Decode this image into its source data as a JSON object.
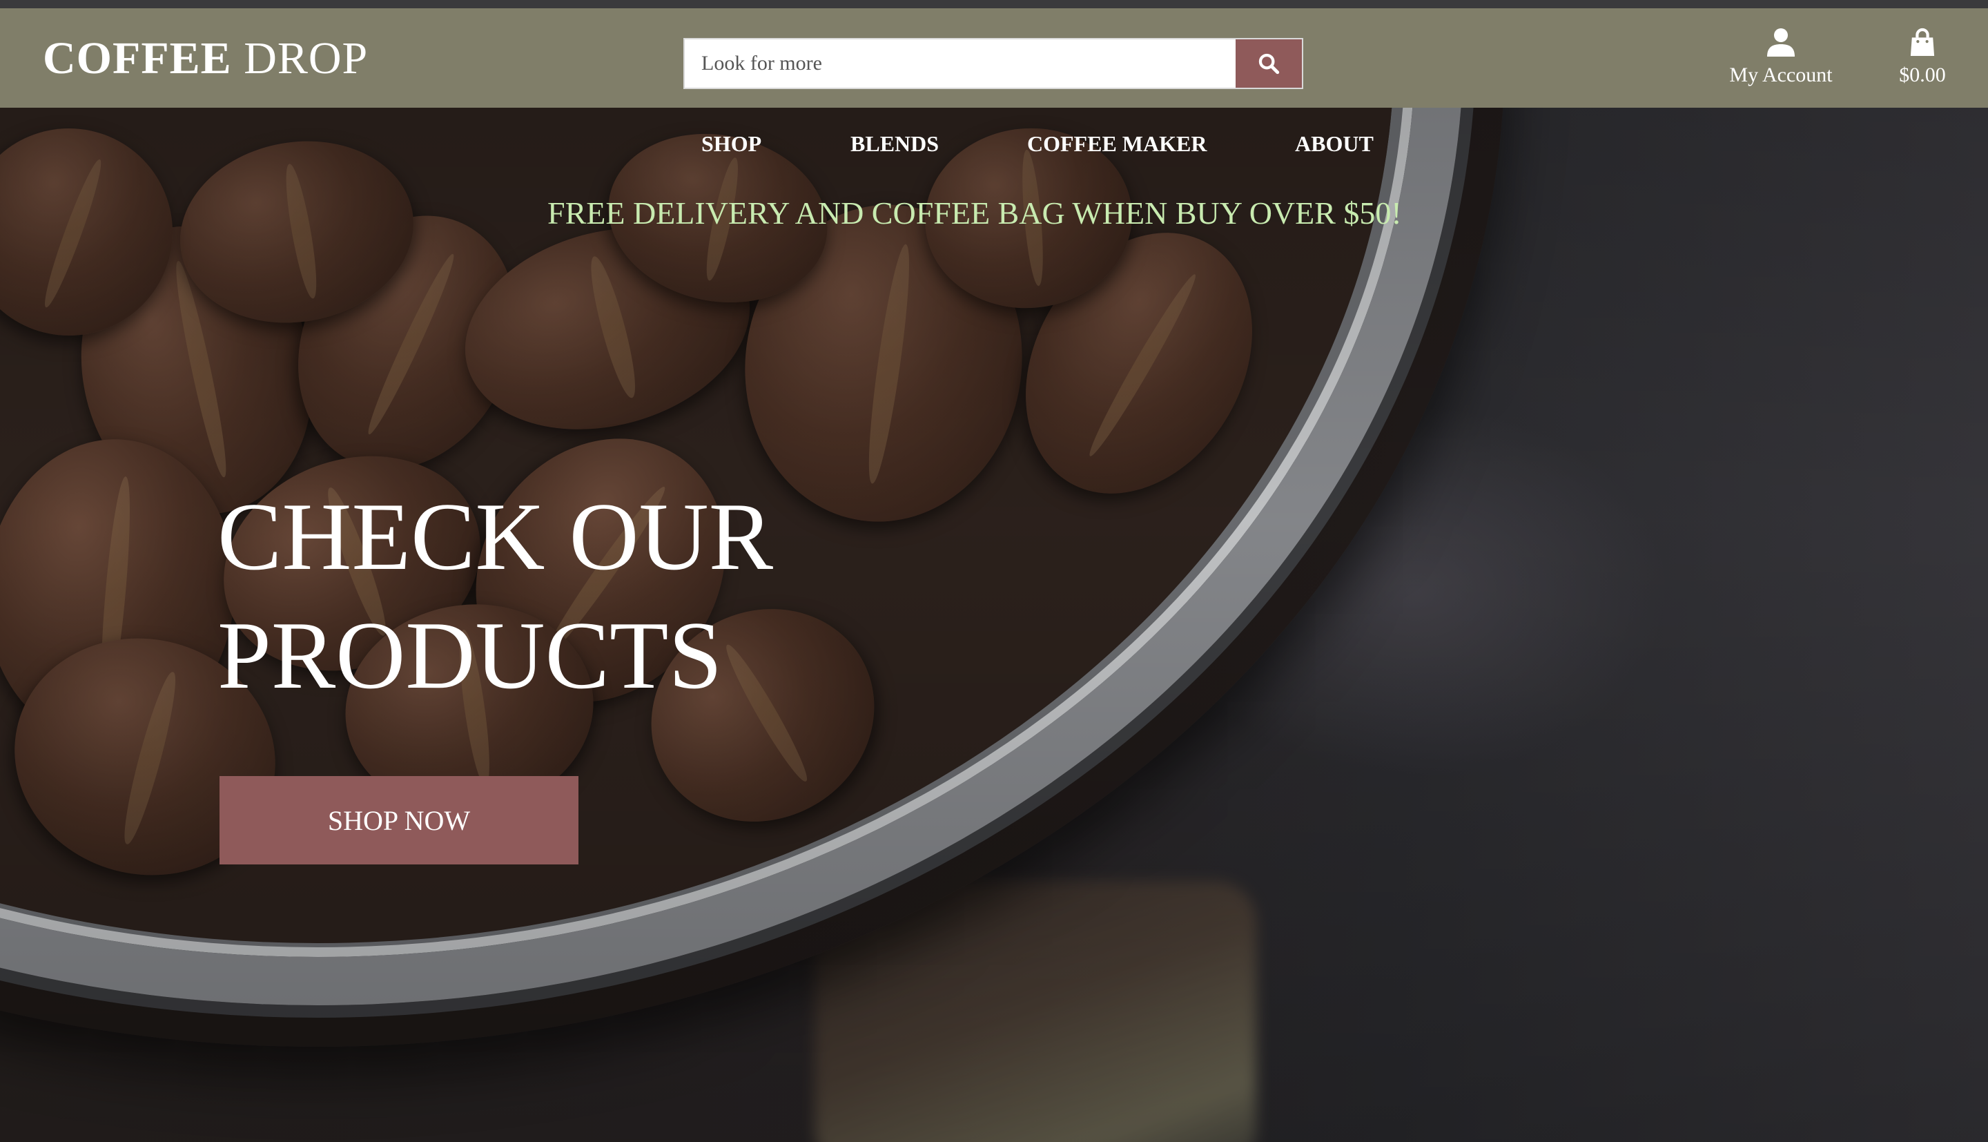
{
  "header": {
    "logo_bold": "COFFEE",
    "logo_light": "DROP",
    "search": {
      "placeholder": "Look for more",
      "button_icon": "search-icon"
    },
    "account": {
      "icon": "user-icon",
      "label": "My Account"
    },
    "cart": {
      "icon": "shopping-bag-icon",
      "total": "$0.00"
    }
  },
  "nav": {
    "items": [
      {
        "label": "SHOP"
      },
      {
        "label": "BLENDS"
      },
      {
        "label": "COFFEE MAKER"
      },
      {
        "label": "ABOUT"
      }
    ]
  },
  "promo": {
    "text": "FREE DELIVERY AND COFFEE BAG WHEN BUY OVER $50!"
  },
  "hero": {
    "headline_line1": "CHECK OUR",
    "headline_line2": "PRODUCTS",
    "cta_label": "SHOP NOW"
  },
  "colors": {
    "header_bg": "#807e69",
    "accent_button": "#8f5a5a",
    "promo_text": "#c8ebb0",
    "text_light": "#ffffff"
  }
}
